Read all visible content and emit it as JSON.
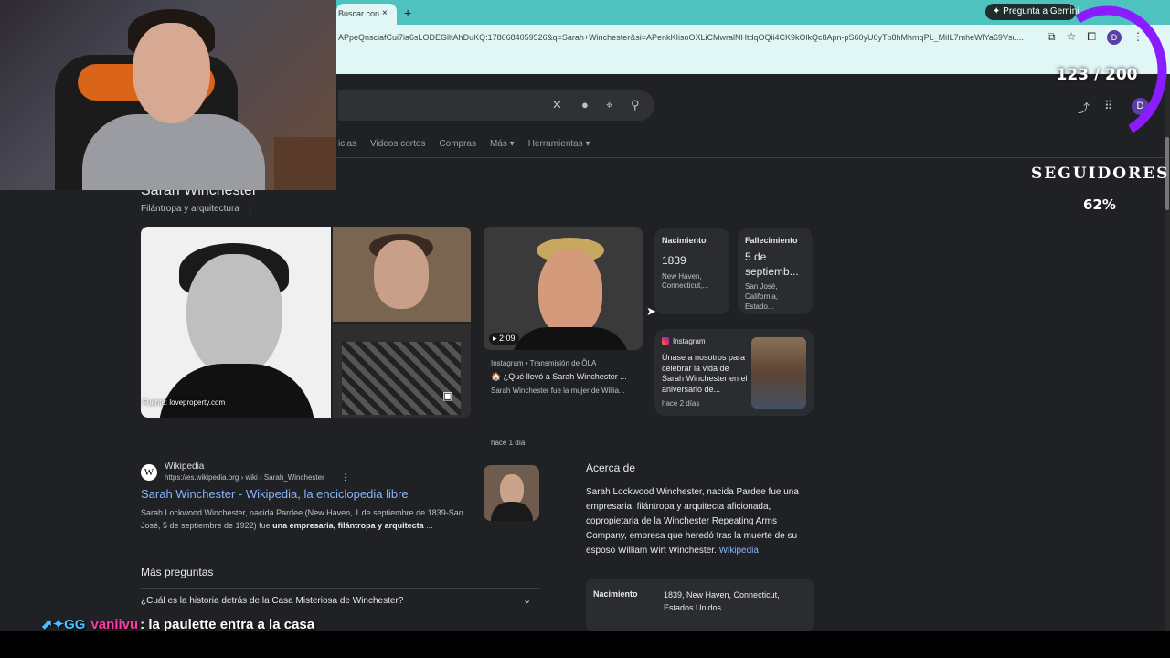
{
  "browser": {
    "tab_title": "Buscar con ",
    "tab_close_icon": "×",
    "new_tab_icon": "+",
    "gemini_label": "✦ Pregunta a Gemini",
    "url": "APpeQnsciafCui7ia6sLODEGlltAhDuKQ:1786684059526&q=Sarah+Winchester&si=APenkKIisoOXLiCMwralNHtdqOQii4CK9kOlkQc8Apn-pS60yU6yTp8hMhmqPL_MiIL7mheWlYa69Vsu..."
  },
  "search": {
    "clear_icon": "✕",
    "mic_icon": "🎤",
    "lens_icon": "⌖",
    "search_icon": "⚲",
    "filters": [
      "icias",
      "Videos cortos",
      "Compras",
      "Más ▾",
      "Herramientas ▾"
    ]
  },
  "header_right": {
    "share_icon": "⤴",
    "apps_icon": "⋮⋮",
    "avatar_letter": "D",
    "profile_letter": "D"
  },
  "overlay": {
    "counter": "123 / 200",
    "seguidores": "SEGUIDORES",
    "percent": "62%",
    "ring_color": "#8a1cff"
  },
  "knowledge_panel": {
    "title": "Sarah Winchester",
    "subtitle": "Filántropa y arquitectura",
    "image_source": "Fuente: loveproperty.com",
    "video": {
      "duration": "▸ 2:09",
      "meta": "Instagram • Transmisión de ÕLA",
      "title": "🏠 ¿Qué llevó a Sarah Winchester ...",
      "desc": "Sarah Winchester fue la mujer de Willia...",
      "time": "hace 1 día"
    },
    "birth": {
      "label": "Nacimiento",
      "value": "1839",
      "place": "New Haven, Connecticut,..."
    },
    "death": {
      "label": "Fallecimiento",
      "value": "5 de septiemb...",
      "place": "San José, California, Estado..."
    },
    "instagram": {
      "source": "Instagram",
      "text": "Únase a nosotros para celebrar la vida de Sarah Winchester en el aniversario de...",
      "time": "hace 2 días"
    }
  },
  "result": {
    "site": "Wikipedia",
    "url": "https://es.wikipedia.org › wiki › Sarah_Winchester",
    "title": "Sarah Winchester - Wikipedia, la enciclopedia libre",
    "snippet": "Sarah Lockwood Winchester, nacida Pardee (New Haven, 1 de septiembre de 1839-San José, 5 de septiembre de 1922) fue ",
    "snippet_bold": "una empresaria, filántropa y arquitecta",
    "snippet_end": " ..."
  },
  "more_questions": {
    "title": "Más preguntas",
    "q1": "¿Cuál es la historia detrás de la Casa Misteriosa de Winchester?"
  },
  "about": {
    "title": "Acerca de",
    "text": "Sarah Lockwood Winchester, nacida Pardee fue una empresaria, filántropa y arquitecta aficionada,  copropietaria de la Winchester Repeating Arms Company, empresa que heredó tras la muerte de su esposo William Wirt Winchester. ",
    "link": "Wikipedia",
    "row_label": "Nacimiento",
    "row_value": "1839, New Haven, Connecticut, Estados Unidos"
  },
  "chat": {
    "badges": "⬈✦GG",
    "user": "vaniivu",
    "message": ": la paulette entra a la casa"
  }
}
